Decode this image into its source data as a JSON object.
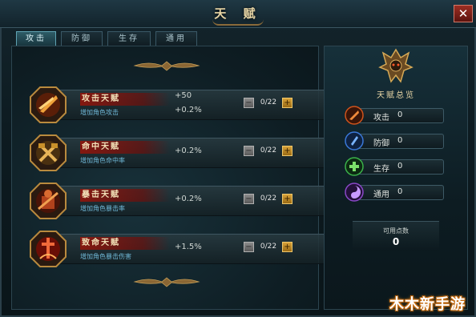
{
  "window": {
    "title": "天 赋",
    "close_label": "✕"
  },
  "tabs": [
    {
      "label": "攻击",
      "active": true
    },
    {
      "label": "防御",
      "active": false
    },
    {
      "label": "生存",
      "active": false
    },
    {
      "label": "通用",
      "active": false
    }
  ],
  "talents": [
    {
      "name": "攻击天赋",
      "desc": "增加角色攻击",
      "value1": "+50",
      "value2": "+0.2%",
      "count": "0/22",
      "icon": "blade-slash-icon",
      "color": "#e07a1c"
    },
    {
      "name": "命中天赋",
      "desc": "增加角色命中率",
      "value1": "",
      "value2": "+0.2%",
      "count": "0/22",
      "icon": "crossed-axes-icon",
      "color": "#c9902a"
    },
    {
      "name": "暴击天赋",
      "desc": "增加角色暴击率",
      "value1": "",
      "value2": "+0.2%",
      "count": "0/22",
      "icon": "armored-warrior-icon",
      "color": "#c0451c"
    },
    {
      "name": "致命天赋",
      "desc": "增加角色暴击伤害",
      "value1": "",
      "value2": "+1.5%",
      "count": "0/22",
      "icon": "burning-sword-icon",
      "color": "#d8361a"
    }
  ],
  "minus_label": "−",
  "plus_label": "+",
  "overview": {
    "title": "天赋总览",
    "stats": [
      {
        "label": "攻击",
        "value": "0",
        "icon": "attack-orb-icon",
        "color": "#d0531c"
      },
      {
        "label": "防御",
        "value": "0",
        "icon": "defense-orb-icon",
        "color": "#3a78d8"
      },
      {
        "label": "生存",
        "value": "0",
        "icon": "survival-orb-icon",
        "color": "#3bb24a"
      },
      {
        "label": "通用",
        "value": "0",
        "icon": "general-orb-icon",
        "color": "#8a48c8"
      }
    ],
    "available_label": "可用点数",
    "available_value": "0"
  },
  "watermark": "木木新手游"
}
